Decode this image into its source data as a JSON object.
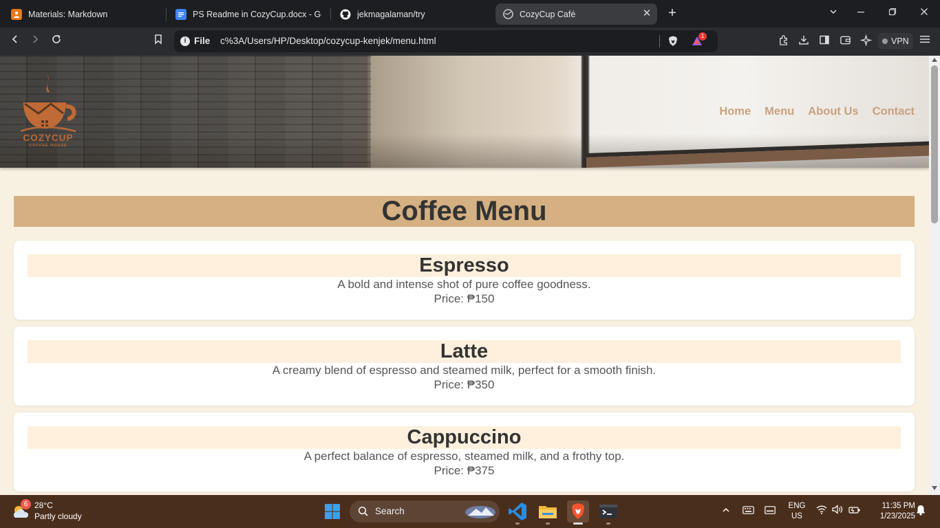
{
  "browser": {
    "tabs": [
      {
        "label": "Materials: Markdown",
        "icon": "school-icon",
        "active": false
      },
      {
        "label": "PS Readme in CozyCup.docx - Goog",
        "icon": "google-docs-icon",
        "active": false
      },
      {
        "label": "jekmagalaman/try",
        "icon": "github-icon",
        "active": false
      },
      {
        "label": "CozyCup Café",
        "icon": "globe-icon",
        "active": true
      }
    ],
    "address": {
      "scheme": "File",
      "url": "c%3A/Users/HP/Desktop/cozycup-kenjek/menu.html"
    },
    "rewards_badge": "1",
    "vpn_label": "VPN"
  },
  "site": {
    "logo": {
      "brand": "COZYCUP",
      "sub": "COFFEE HOUSE"
    },
    "nav": [
      "Home",
      "Menu",
      "About Us",
      "Contact"
    ],
    "menu_title": "Coffee Menu",
    "items": [
      {
        "name": "Espresso",
        "description": "A bold and intense shot of pure coffee goodness.",
        "price": "Price: ₱150"
      },
      {
        "name": "Latte",
        "description": "A creamy blend of espresso and steamed milk, perfect for a smooth finish.",
        "price": "Price: ₱350"
      },
      {
        "name": "Cappuccino",
        "description": "A perfect balance of espresso, steamed milk, and a frothy top.",
        "price": "Price: ₱375"
      }
    ],
    "colors": {
      "accent": "#d4b083",
      "item_header": "#ffefdd",
      "background": "#f8f1e2",
      "nav_text": "#c9a27f"
    }
  },
  "taskbar": {
    "weather": {
      "temp": "28°C",
      "condition": "Partly cloudy",
      "badge": "6"
    },
    "search_label": "Search",
    "apps": [
      "vscode-icon",
      "file-explorer-icon",
      "brave-icon",
      "terminal-icon"
    ],
    "language": {
      "lang": "ENG",
      "region": "US"
    },
    "clock": {
      "time": "11:35 PM",
      "date": "1/23/2025"
    }
  }
}
